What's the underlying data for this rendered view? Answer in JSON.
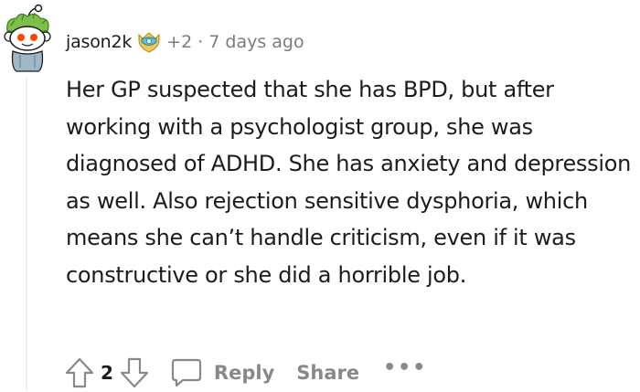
{
  "comment": {
    "username": "jason2k",
    "awards": "+2",
    "separator": "·",
    "timestamp": "7 days ago",
    "body": "Her GP suspected that she has BPD, but after working with a psychologist group, she was diagnosed of ADHD. She has anxiety and depression as well. Also rejection sensitive dysphoria, which means she can’t handle criticism, even if it was constructive or she did a horrible job.",
    "vote_count": "2",
    "reply_label": "Reply",
    "share_label": "Share",
    "more_label": "•••"
  },
  "icons": {
    "avatar": "snoo-avatar-icon",
    "badge": "achievement-badge-icon",
    "upvote": "upvote-arrow-icon",
    "downvote": "downvote-arrow-icon",
    "reply": "speech-bubble-icon",
    "more": "more-options-icon"
  },
  "colors": {
    "text": "#1c1c1c",
    "meta": "#7c7c7c",
    "action": "#878a8c",
    "thread_line": "#edeff1"
  }
}
